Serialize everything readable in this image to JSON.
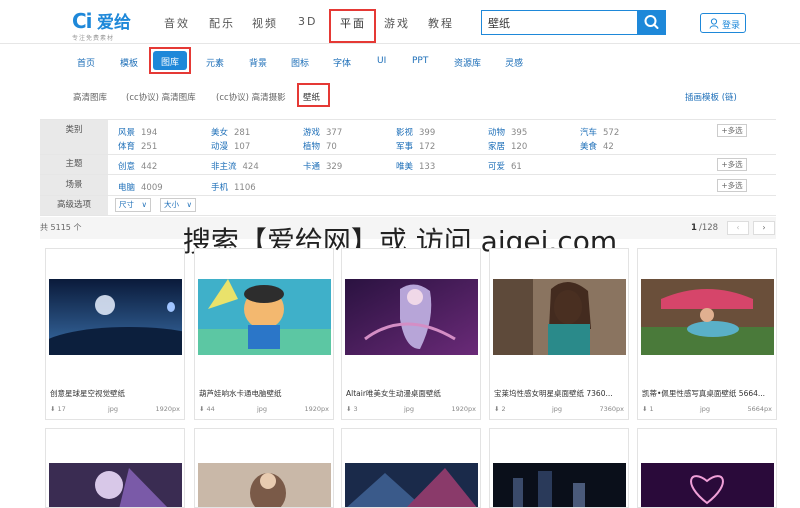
{
  "logo": {
    "mark": "Ci",
    "name": "爱给",
    "tagline": "专注免费素材"
  },
  "top_nav": [
    "音效",
    "配乐",
    "视频",
    "3D",
    "平面",
    "游戏",
    "教程"
  ],
  "search": {
    "value": "壁纸"
  },
  "login": {
    "label": "登录"
  },
  "sub_nav": [
    "首页",
    "模板",
    "图库",
    "元素",
    "背景",
    "图标",
    "字体",
    "UI",
    "PPT",
    "资源库",
    "灵感"
  ],
  "sub_nav_active": "图库",
  "gallery_tabs": [
    "高清图库",
    "(cc协议) 高清图库",
    "(cc协议) 高清摄影",
    "壁纸"
  ],
  "gallery_tab_active": "壁纸",
  "right_link": "插画模板 (链)",
  "filters": {
    "category": {
      "label": "类别",
      "items": [
        {
          "name": "风景",
          "count": "194"
        },
        {
          "name": "美女",
          "count": "281"
        },
        {
          "name": "游戏",
          "count": "377"
        },
        {
          "name": "影视",
          "count": "399"
        },
        {
          "name": "动物",
          "count": "395"
        },
        {
          "name": "汽车",
          "count": "572"
        },
        {
          "name": "体育",
          "count": "251"
        },
        {
          "name": "动漫",
          "count": "107"
        },
        {
          "name": "植物",
          "count": "70"
        },
        {
          "name": "军事",
          "count": "172"
        },
        {
          "name": "家居",
          "count": "120"
        },
        {
          "name": "美食",
          "count": "42"
        }
      ]
    },
    "theme": {
      "label": "主题",
      "items": [
        {
          "name": "创意",
          "count": "442"
        },
        {
          "name": "非主流",
          "count": "424"
        },
        {
          "name": "卡通",
          "count": "329"
        },
        {
          "name": "唯美",
          "count": "133"
        },
        {
          "name": "可爱",
          "count": "61"
        }
      ]
    },
    "scene": {
      "label": "场景",
      "items": [
        {
          "name": "电脑",
          "count": "4009"
        },
        {
          "name": "手机",
          "count": "1106"
        }
      ]
    },
    "advanced": {
      "label": "高级选项",
      "select1": "尺寸",
      "select2": "大小"
    },
    "more_label": "+多选"
  },
  "results": {
    "total": "共 5115 个",
    "page": "1",
    "pages": "/128"
  },
  "overlay": "搜索【爱给网】或 访问 aigei.com",
  "cards": [
    {
      "title": "创意星球星空视觉壁纸",
      "downloads": "17",
      "format": "jpg",
      "size": "1920px"
    },
    {
      "title": "葫芦娃响水卡通电脑壁纸",
      "downloads": "44",
      "format": "jpg",
      "size": "1920px"
    },
    {
      "title": "Altair唯美女生动漫桌面壁纸",
      "downloads": "3",
      "format": "jpg",
      "size": "1920px"
    },
    {
      "title": "宝莱坞性感女明星桌面壁纸 7360...",
      "downloads": "2",
      "format": "jpg",
      "size": "7360px"
    },
    {
      "title": "凯蒂•佩里性感写真桌面壁纸 5664...",
      "downloads": "1",
      "format": "jpg",
      "size": "5664px"
    }
  ],
  "colors": {
    "accent": "#1e88d9",
    "highlight_box": "#e53935"
  }
}
